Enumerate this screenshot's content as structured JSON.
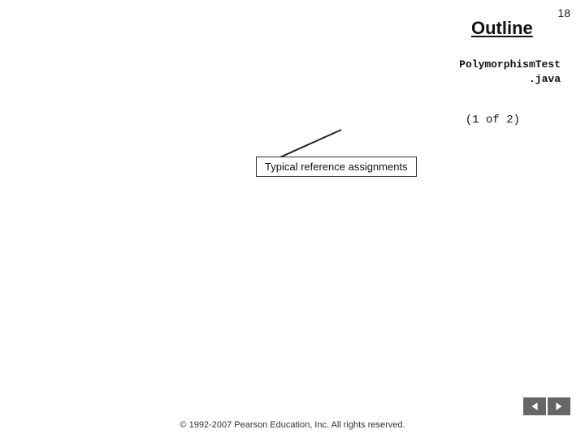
{
  "page": {
    "number": "18",
    "title": "Outline",
    "filename_line1": "PolymorphismTest",
    "filename_line2": ".java",
    "part_label": "(1 of  2)",
    "typical_box_label": "Typical reference assignments",
    "copyright": "© 1992-2007 Pearson Education, Inc.  All rights reserved.",
    "nav": {
      "prev_label": "◄",
      "next_label": "►"
    }
  }
}
